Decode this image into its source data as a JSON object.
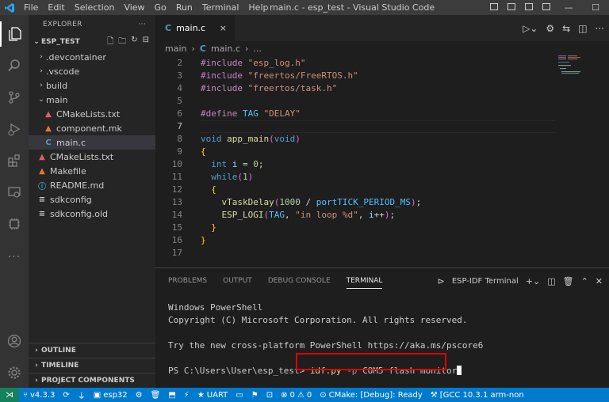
{
  "titlebar": {
    "logo": "vscode-logo",
    "menu": [
      "File",
      "Edit",
      "Selection",
      "View",
      "Go",
      "Run",
      "Terminal",
      "Help"
    ],
    "title": "main.c - esp_test - Visual Studio Code"
  },
  "activity": [
    "explorer-icon",
    "search-icon",
    "source-control-icon",
    "run-debug-icon",
    "extensions-icon",
    "remote-explorer-icon",
    "esp-idf-icon",
    "more-icon",
    "account-icon",
    "settings-gear-icon"
  ],
  "sidebar": {
    "header": "EXPLORER",
    "more": "···",
    "project": "ESP_TEST",
    "tree": [
      {
        "label": ".devcontainer",
        "type": "folder",
        "expanded": false,
        "depth": 1
      },
      {
        "label": ".vscode",
        "type": "folder",
        "expanded": false,
        "depth": 1
      },
      {
        "label": "build",
        "type": "folder",
        "expanded": false,
        "depth": 1
      },
      {
        "label": "main",
        "type": "folder",
        "expanded": true,
        "depth": 1
      },
      {
        "label": "CMakeLists.txt",
        "type": "cmake",
        "depth": 2
      },
      {
        "label": "component.mk",
        "type": "make",
        "depth": 2
      },
      {
        "label": "main.c",
        "type": "c",
        "depth": 2,
        "selected": true
      },
      {
        "label": "CMakeLists.txt",
        "type": "cmake",
        "depth": 1
      },
      {
        "label": "Makefile",
        "type": "make",
        "depth": 1
      },
      {
        "label": "README.md",
        "type": "info",
        "depth": 1
      },
      {
        "label": "sdkconfig",
        "type": "list",
        "depth": 1
      },
      {
        "label": "sdkconfig.old",
        "type": "list",
        "depth": 1
      }
    ],
    "sections": [
      "OUTLINE",
      "TIMELINE",
      "PROJECT COMPONENTS"
    ]
  },
  "tab": {
    "icon_letter": "C",
    "label": "main.c",
    "close": "×"
  },
  "breadcrumb": {
    "folder": "main",
    "sep": "›",
    "icon_letter": "C",
    "file": "main.c",
    "ellipsis": "..."
  },
  "editor": {
    "lines": [
      {
        "n": "2",
        "code": "#include \"esp_log.h\""
      },
      {
        "n": "3",
        "code": "#include \"freertos/FreeRTOS.h\""
      },
      {
        "n": "4",
        "code": "#include \"freertos/task.h\""
      },
      {
        "n": "5",
        "code": ""
      },
      {
        "n": "6",
        "code": "#define TAG \"DELAY\""
      },
      {
        "n": "7",
        "code": ""
      },
      {
        "n": "8",
        "code": "void app_main(void)"
      },
      {
        "n": "9",
        "code": "{"
      },
      {
        "n": "10",
        "code": "  int i = 0;"
      },
      {
        "n": "11",
        "code": "  while(1)"
      },
      {
        "n": "12",
        "code": "  {"
      },
      {
        "n": "13",
        "code": "    vTaskDelay(1000 / portTICK_PERIOD_MS);"
      },
      {
        "n": "14",
        "code": "    ESP_LOGI(TAG, \"in loop %d\", i++);"
      },
      {
        "n": "15",
        "code": "  }"
      },
      {
        "n": "16",
        "code": "}"
      },
      {
        "n": "17",
        "code": ""
      }
    ],
    "current_line": "7"
  },
  "panel": {
    "tabs": [
      "PROBLEMS",
      "OUTPUT",
      "DEBUG CONSOLE",
      "TERMINAL"
    ],
    "active_tab": "TERMINAL",
    "terminal_name": "ESP-IDF Terminal",
    "terminal": {
      "line1": "Windows PowerShell",
      "line2": "Copyright (C) Microsoft Corporation. All rights reserved.",
      "line3": "Try the new cross-platform PowerShell https://aka.ms/pscore6",
      "prompt": "PS C:\\Users\\User\\esp_test>",
      "cmd": "idf.py",
      "flag": "-p",
      "args": "COM5 flash monitor"
    }
  },
  "statusbar": {
    "version": "v4.3.3",
    "target": "esp32",
    "uart": "UART",
    "errors": "0",
    "warnings": "0",
    "cmake": "CMake: [Debug]: Ready",
    "gcc": "[GCC 10.3.1 arm-non"
  },
  "colors": {
    "accent": "#007acc",
    "remote": "#16825d",
    "highlight_box": "#e00000",
    "keyword": "#569cd6",
    "string": "#ce9178",
    "function": "#dcdcaa",
    "number": "#b5cea8",
    "constant": "#4fc1ff",
    "cmd_yellow": "#dcdcaa"
  }
}
